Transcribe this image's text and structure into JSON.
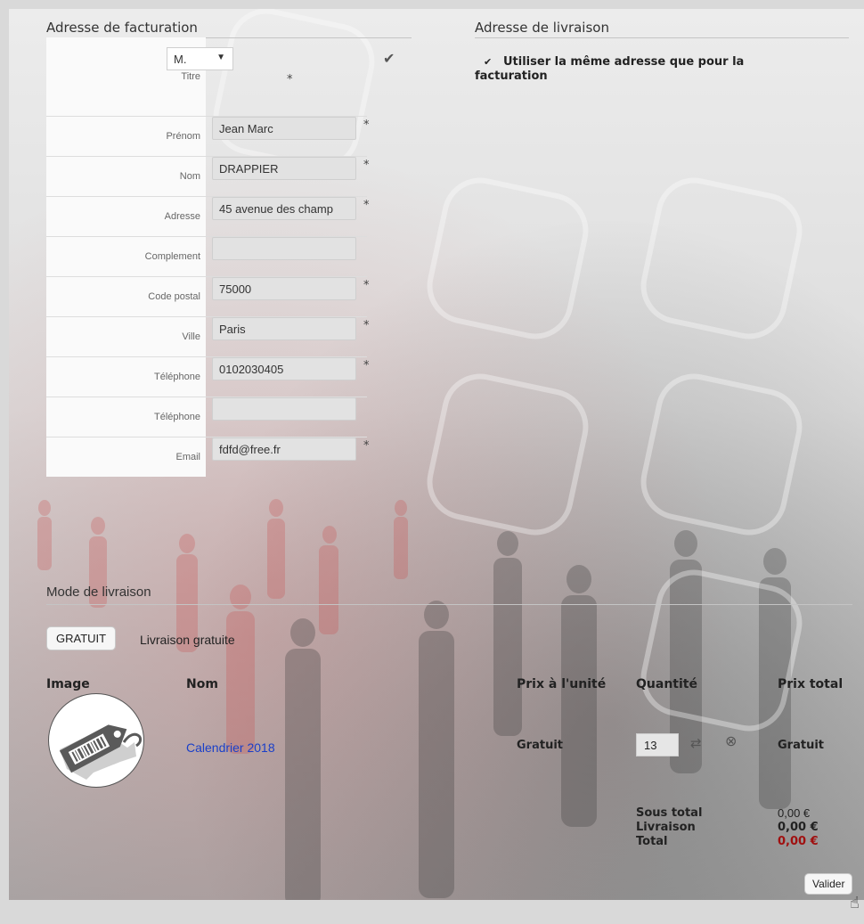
{
  "billing": {
    "heading": "Adresse de facturation",
    "fields": [
      {
        "label": "Titre",
        "type": "select",
        "value": "M.",
        "required": true
      },
      {
        "label": "Prénom",
        "value": "Jean Marc",
        "required": true
      },
      {
        "label": "Nom",
        "value": "DRAPPIER",
        "required": true
      },
      {
        "label": "Adresse",
        "value": "45 avenue des champ",
        "required": true
      },
      {
        "label": "Complement",
        "value": "",
        "required": false
      },
      {
        "label": "Code postal",
        "value": "75000",
        "required": true
      },
      {
        "label": "Ville",
        "value": "Paris",
        "required": true
      },
      {
        "label": "Téléphone",
        "value": "0102030405",
        "required": true
      },
      {
        "label": "Téléphone",
        "value": "",
        "required": false
      },
      {
        "label": "Email",
        "value": "fdfd@free.fr",
        "required": true
      }
    ],
    "required_mark": "*"
  },
  "shipping": {
    "heading": "Adresse de livraison",
    "same_address_label": "Utiliser la même adresse que pour la facturation",
    "same_address_checked": true
  },
  "delivery": {
    "heading": "Mode de livraison",
    "button_label": "GRATUIT",
    "description": "Livraison gratuite"
  },
  "cart": {
    "headers": {
      "image": "Image",
      "name": "Nom",
      "unit_price": "Prix à l'unité",
      "quantity": "Quantité",
      "total_price": "Prix total"
    },
    "items": [
      {
        "name": "Calendrier 2018",
        "unit_price": "Gratuit",
        "quantity": "13",
        "total_price": "Gratuit",
        "icon": "price-tag-icon"
      }
    ],
    "summary": {
      "subtotal_label": "Sous total",
      "subtotal_value": "0,00 €",
      "shipping_label": "Livraison",
      "shipping_value": "0,00 €",
      "total_label": "Total",
      "total_value": "0,00 €"
    },
    "submit_label": "Valider"
  },
  "colors": {
    "link": "#1a3fc9",
    "total": "#a01010"
  }
}
